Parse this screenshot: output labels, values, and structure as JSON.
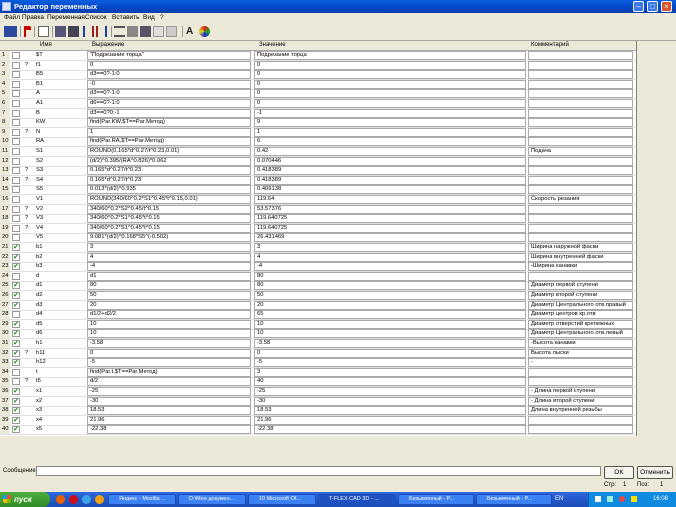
{
  "window": {
    "title": "Редактор переменных"
  },
  "menu": [
    "Файл",
    "Правка",
    "Переменная",
    "Список",
    "Вставить",
    "Вид",
    "?"
  ],
  "headers": {
    "name": "Имя",
    "expr": "Выражение",
    "value": "Значение",
    "comment": "Комментарий"
  },
  "rows": [
    {
      "n": "1",
      "c": false,
      "q": "",
      "name": "$T",
      "expr": "\"Подрезание торца\"",
      "value": "Подрезание торца",
      "comment": ""
    },
    {
      "n": "2",
      "c": false,
      "q": "?",
      "name": "f1",
      "expr": "0",
      "value": "0",
      "comment": ""
    },
    {
      "n": "3",
      "c": false,
      "q": "",
      "name": "B5",
      "expr": "d3==0?-1:0",
      "value": "0",
      "comment": ""
    },
    {
      "n": "4",
      "c": false,
      "q": "",
      "name": "B1",
      "expr": "-0",
      "value": "0",
      "comment": ""
    },
    {
      "n": "5",
      "c": false,
      "q": "",
      "name": "A",
      "expr": "d3==0?-1:0",
      "value": "0",
      "comment": ""
    },
    {
      "n": "6",
      "c": false,
      "q": "",
      "name": "A1",
      "expr": "d6==0?-1:0",
      "value": "0",
      "comment": ""
    },
    {
      "n": "7",
      "c": false,
      "q": "",
      "name": "B",
      "expr": "d3==0?0:-1",
      "value": "-1",
      "comment": ""
    },
    {
      "n": "8",
      "c": false,
      "q": "",
      "name": "KW",
      "expr": "find(Par.KW,$T==Par.Метод)",
      "value": "9",
      "comment": ""
    },
    {
      "n": "9",
      "c": false,
      "q": "?",
      "name": "N",
      "expr": "1",
      "value": "1",
      "comment": ""
    },
    {
      "n": "10",
      "c": false,
      "q": "",
      "name": "RA",
      "expr": "find(Par.RA,$T==Par.Метод)",
      "value": "6",
      "comment": ""
    },
    {
      "n": "11",
      "c": false,
      "q": "",
      "name": "S1",
      "expr": "ROUND(0.165*d^0.27/t^0.23,0.01)",
      "value": "0.42",
      "comment": "Подача"
    },
    {
      "n": "12",
      "c": false,
      "q": "",
      "name": "S2",
      "expr": "(d/2)^0.395/(RA^0.826)*0.062",
      "value": "0.070446",
      "comment": ""
    },
    {
      "n": "13",
      "c": false,
      "q": "?",
      "name": "S3",
      "expr": "0.165*d^0.27/t^0.23",
      "value": "0.418389",
      "comment": ""
    },
    {
      "n": "14",
      "c": false,
      "q": "?",
      "name": "S4",
      "expr": "0.165*d^0.27/t^0.23",
      "value": "0.418389",
      "comment": ""
    },
    {
      "n": "15",
      "c": false,
      "q": "",
      "name": "S5",
      "expr": "0.013*(d/2)^0.935",
      "value": "0.409138",
      "comment": ""
    },
    {
      "n": "16",
      "c": false,
      "q": "",
      "name": "V1",
      "expr": "ROUND(340/60^0.2*S1^0.45*t^0.15,0.01)",
      "value": "119.64",
      "comment": "Скорость резания"
    },
    {
      "n": "17",
      "c": false,
      "q": "?",
      "name": "V2",
      "expr": "340/60^0.2*S2^0.45/t^0.15",
      "value": "53.57376",
      "comment": ""
    },
    {
      "n": "18",
      "c": false,
      "q": "?",
      "name": "V3",
      "expr": "340/60^0.2*S1^0.45*t^0.15",
      "value": "119.640725",
      "comment": ""
    },
    {
      "n": "19",
      "c": false,
      "q": "?",
      "name": "V4",
      "expr": "340/60^0.2*S1^0.45*t^0.15",
      "value": "119.640725",
      "comment": ""
    },
    {
      "n": "20",
      "c": false,
      "q": "",
      "name": "V5",
      "expr": "9.081*(d/2)^0.168*S5^(-0.502)",
      "value": "26.431469",
      "comment": ""
    },
    {
      "n": "21",
      "c": true,
      "q": "",
      "name": "b1",
      "expr": "3",
      "value": "3",
      "comment": "Ширина наружной фаски"
    },
    {
      "n": "22",
      "c": true,
      "q": "",
      "name": "b2",
      "expr": "4",
      "value": "4",
      "comment": "Ширина внутренней фаски"
    },
    {
      "n": "23",
      "c": true,
      "q": "",
      "name": "b3",
      "expr": "-4",
      "value": "-4",
      "comment": "-Ширина канавки"
    },
    {
      "n": "24",
      "c": false,
      "q": "",
      "name": "d",
      "expr": "d1",
      "value": "80",
      "comment": ""
    },
    {
      "n": "25",
      "c": true,
      "q": "",
      "name": "d1",
      "expr": "80",
      "value": "80",
      "comment": "Диаметр первой ступени"
    },
    {
      "n": "26",
      "c": true,
      "q": "",
      "name": "d2",
      "expr": "50",
      "value": "50",
      "comment": "Диаметр второй ступени"
    },
    {
      "n": "27",
      "c": true,
      "q": "",
      "name": "d3",
      "expr": "20",
      "value": "20",
      "comment": "Диаметр Центрального отв.правый"
    },
    {
      "n": "28",
      "c": false,
      "q": "",
      "name": "d4",
      "expr": "d1/2+d2/2",
      "value": "65",
      "comment": "Диаметр центров кр.отв"
    },
    {
      "n": "29",
      "c": true,
      "q": "",
      "name": "d5",
      "expr": "10",
      "value": "10",
      "comment": "Диаметр отверстий крепежных"
    },
    {
      "n": "30",
      "c": true,
      "q": "",
      "name": "d6",
      "expr": "10",
      "value": "10",
      "comment": "Диаметр Центрального отв.левый"
    },
    {
      "n": "31",
      "c": true,
      "q": "",
      "name": "h1",
      "expr": "-3.58",
      "value": "-3.58",
      "comment": "-Высота канавки"
    },
    {
      "n": "32",
      "c": true,
      "q": "?",
      "name": "h11",
      "expr": "0",
      "value": "0",
      "comment": "Высота лыски"
    },
    {
      "n": "33",
      "c": true,
      "q": "",
      "name": "h12",
      "expr": "-5",
      "value": "-5",
      "comment": "-"
    },
    {
      "n": "34",
      "c": false,
      "q": "",
      "name": "t",
      "expr": "find(Par.t,$T==Par.Метод)",
      "value": "3",
      "comment": ""
    },
    {
      "n": "35",
      "c": false,
      "q": "?",
      "name": "t5",
      "expr": "d/2",
      "value": "40",
      "comment": ""
    },
    {
      "n": "36",
      "c": true,
      "q": "",
      "name": "x1",
      "expr": "-25",
      "value": "-25",
      "comment": "- Длина первой ступени"
    },
    {
      "n": "37",
      "c": true,
      "q": "",
      "name": "x2",
      "expr": "-30",
      "value": "-30",
      "comment": "- Длина второй ступени"
    },
    {
      "n": "38",
      "c": true,
      "q": "",
      "name": "x3",
      "expr": "18.53",
      "value": "18.53",
      "comment": "Длина внутренней резьбы"
    },
    {
      "n": "39",
      "c": true,
      "q": "",
      "name": "x4",
      "expr": "21.96",
      "value": "21.96",
      "comment": ""
    },
    {
      "n": "40",
      "c": true,
      "q": "",
      "name": "x5",
      "expr": "-22.38",
      "value": "-22.38",
      "comment": ""
    }
  ],
  "status": {
    "message_label": "Сообщение:",
    "ok": "OK",
    "cancel": "Отменить",
    "page_label": "Стр:",
    "page_a": "1",
    "pos_label": "Поз:",
    "page_b": "1"
  },
  "taskbar": {
    "start": "пуск",
    "tasks": [
      "Яндекс - Mozilla ...",
      "D:\\Мои докумен...",
      "10 Microsoft Of...",
      "T-FLEX CAD 3D - ...",
      "Безымянный - P...",
      "Безымянный - P..."
    ],
    "lang": "EN",
    "clock": "16:08"
  },
  "colors": {
    "titlebar": "#0a5fe0",
    "taskbar": "#2457c8",
    "start": "#2e8b25",
    "check": "#1a8a1a"
  }
}
